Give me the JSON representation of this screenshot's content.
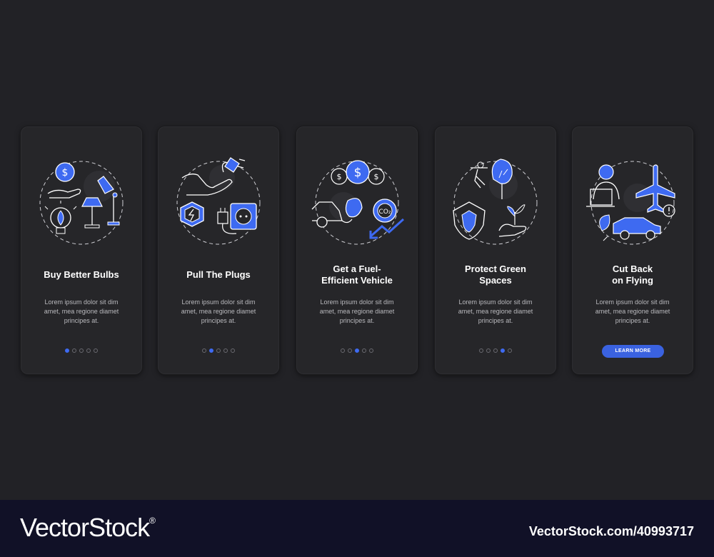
{
  "cards": [
    {
      "title_lines": [
        "Buy Better Bulbs",
        ""
      ],
      "body_lines": [
        "Lorem ipsum dolor sit dim",
        "amet, mea regione diamet",
        "principes at."
      ],
      "pagination": {
        "total": 5,
        "active": 1
      }
    },
    {
      "title_lines": [
        "Pull The Plugs",
        ""
      ],
      "body_lines": [
        "Lorem ipsum dolor sit dim",
        "amet, mea regione diamet",
        "principes at."
      ],
      "pagination": {
        "total": 5,
        "active": 2
      }
    },
    {
      "title_lines": [
        "Get a Fuel-",
        "Efficient Vehicle"
      ],
      "body_lines": [
        "Lorem ipsum dolor sit dim",
        "amet, mea regione diamet",
        "principes at."
      ],
      "pagination": {
        "total": 5,
        "active": 3
      }
    },
    {
      "title_lines": [
        "Protect Green",
        "Spaces"
      ],
      "body_lines": [
        "Lorem ipsum dolor sit dim",
        "amet, mea regione diamet",
        "principes at."
      ],
      "pagination": {
        "total": 5,
        "active": 4
      }
    },
    {
      "title_lines": [
        "Cut Back",
        "on Flying"
      ],
      "body_lines": [
        "Lorem ipsum dolor sit dim",
        "amet, mea regione diamet",
        "principes at."
      ],
      "button_label": "LEARN MORE"
    }
  ],
  "icons": [
    "bulb-icons",
    "plug-icons",
    "vehicle-co2-icons",
    "green-space-icons",
    "flight-icons"
  ],
  "colors": {
    "accent": "#3e6af1",
    "card": "#262629",
    "background": "#222226"
  },
  "footer": {
    "brand": "VectorStock",
    "registered": "®",
    "image_id": "VectorStock.com/40993717"
  }
}
